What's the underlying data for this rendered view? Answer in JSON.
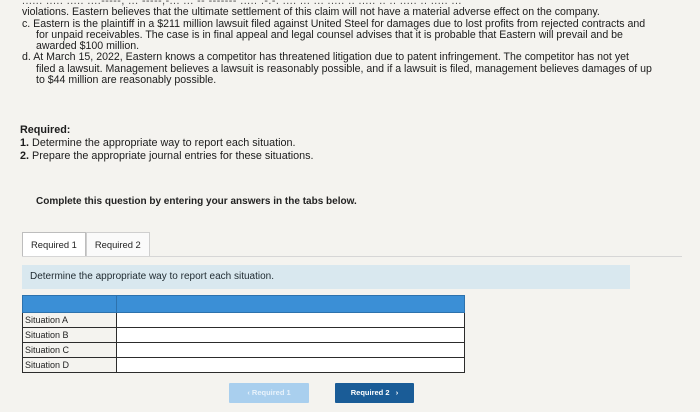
{
  "problem": {
    "line_top_fragment": "...... ..... .....  ....-----, ... -----,-... ... -- ------- ..... .-.-. .... ... ... ..... .. ..... .. .. ..... .. ..... ...",
    "lines_b": [
      "violations. Eastern believes that the ultimate settlement of this claim will not have a material adverse effect on the company."
    ],
    "item_c": [
      "c. Eastern is the plaintiff in a $211 million lawsuit filed against United Steel for damages due to lost profits from rejected contracts and",
      "for unpaid receivables. The case is in final appeal and legal counsel advises that it is probable that Eastern will prevail and be",
      "awarded $100 million."
    ],
    "item_d": [
      "d. At March 15, 2022, Eastern knows a competitor has threatened litigation due to patent infringement. The competitor has not yet",
      "filed a lawsuit. Management believes a lawsuit is reasonably possible, and if a lawsuit is filed, management believes damages of up",
      "to $44 million are reasonably possible."
    ]
  },
  "required": {
    "heading": "Required:",
    "items": [
      {
        "num": "1.",
        "text": "Determine the appropriate way to report each situation."
      },
      {
        "num": "2.",
        "text": "Prepare the appropriate journal entries for these situations."
      }
    ]
  },
  "prompt": "Complete this question by entering your answers in the tabs below.",
  "tabs": [
    {
      "label": "Required 1",
      "active": true
    },
    {
      "label": "Required 2",
      "active": false
    }
  ],
  "instruction": "Determine the appropriate way to report each situation.",
  "table": {
    "rows": [
      {
        "label": "Situation A",
        "value": ""
      },
      {
        "label": "Situation B",
        "value": ""
      },
      {
        "label": "Situation C",
        "value": ""
      },
      {
        "label": "Situation D",
        "value": ""
      }
    ]
  },
  "nav": {
    "prev_label": "Required 1",
    "next_label": "Required 2"
  },
  "colors": {
    "header_blue": "#3b8fd6",
    "instruction_bg": "#d9e8ef",
    "next_button": "#1a5c97",
    "prev_button_disabled": "#a9cfee"
  }
}
